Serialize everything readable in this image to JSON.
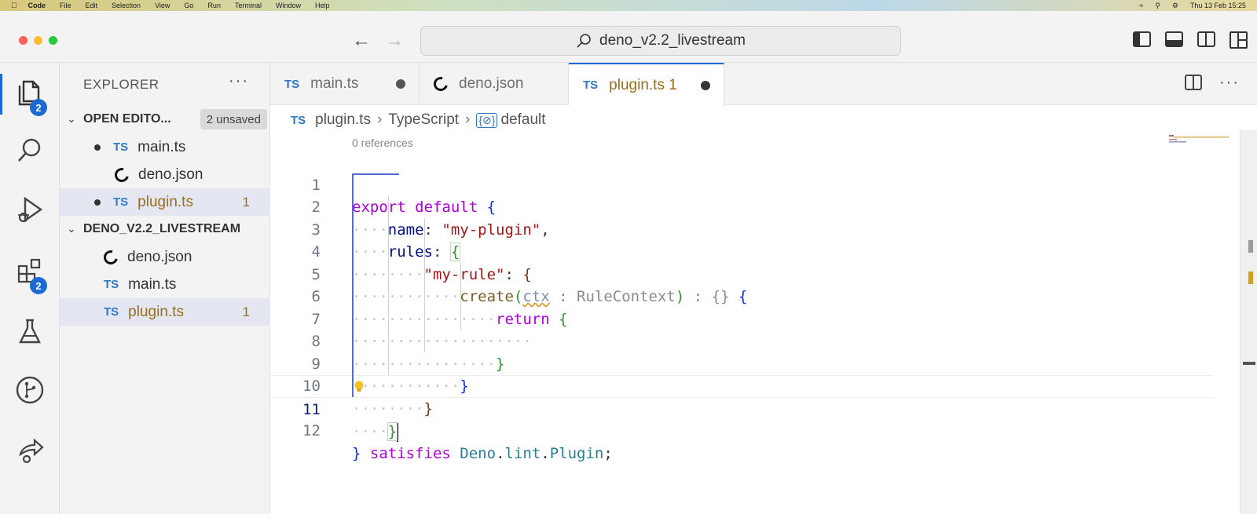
{
  "menubar": {
    "app": "Code",
    "items": [
      "File",
      "Edit",
      "Selection",
      "View",
      "Go",
      "Run",
      "Terminal",
      "Window",
      "Help"
    ],
    "clock": "Thu 13 Feb 15:25"
  },
  "titlebar": {
    "search_text": "deno_v2.2_livestream"
  },
  "activity": {
    "explorer_badge": "2",
    "extensions_badge": "2"
  },
  "sidebar": {
    "title": "EXPLORER",
    "more": "···",
    "open_editors": {
      "label": "OPEN EDITO...",
      "unsaved": "2 unsaved",
      "items": [
        {
          "name": "main.ts",
          "icon": "TS"
        },
        {
          "name": "deno.json"
        },
        {
          "name": "plugin.ts",
          "icon": "TS",
          "problems": "1"
        }
      ]
    },
    "project": {
      "label": "DENO_V2.2_LIVESTREAM",
      "items": [
        {
          "name": "deno.json"
        },
        {
          "name": "main.ts",
          "icon": "TS"
        },
        {
          "name": "plugin.ts",
          "icon": "TS",
          "problems": "1"
        }
      ]
    }
  },
  "tabs": [
    {
      "label": "main.ts",
      "icon": "TS"
    },
    {
      "label": "deno.json"
    },
    {
      "label": "plugin.ts 1",
      "icon": "TS"
    }
  ],
  "breadcrumb": {
    "icon": "TS",
    "file": "plugin.ts",
    "lang": "TypeScript",
    "symbol_icon": "{⊘}",
    "symbol": "default"
  },
  "codelens": "0 references",
  "code": {
    "line_numbers": [
      "1",
      "2",
      "3",
      "4",
      "5",
      "6",
      "7",
      "8",
      "9",
      "10",
      "11",
      "12"
    ],
    "l1": {
      "export": "export",
      "default": "default",
      "brace": "{"
    },
    "l2": {
      "key": "name",
      "colon": ": ",
      "value": "\"my-plugin\"",
      "comma": ","
    },
    "l3": {
      "key": "rules",
      "colon": ": ",
      "brace": "{"
    },
    "l4": {
      "key": "\"my-rule\"",
      "colon": ": ",
      "brace": "{"
    },
    "l5": {
      "fn": "create",
      "open": "(",
      "param": "ctx",
      "hint_type": " : RuleContext",
      "close": ")",
      "ret_hint": " : {}",
      "brace": " {"
    },
    "l6": {
      "kw": "return",
      "brace": " {"
    },
    "l8": {
      "brace": "}"
    },
    "l9": {
      "brace": "}"
    },
    "l10": {
      "brace": "}"
    },
    "l11": {
      "brace": "}"
    },
    "l12": {
      "brace": "}",
      "satisfies": " satisfies ",
      "deno": "Deno",
      "dot1": ".",
      "lint": "lint",
      "dot2": ".",
      "plugin": "Plugin",
      "semi": ";"
    }
  }
}
